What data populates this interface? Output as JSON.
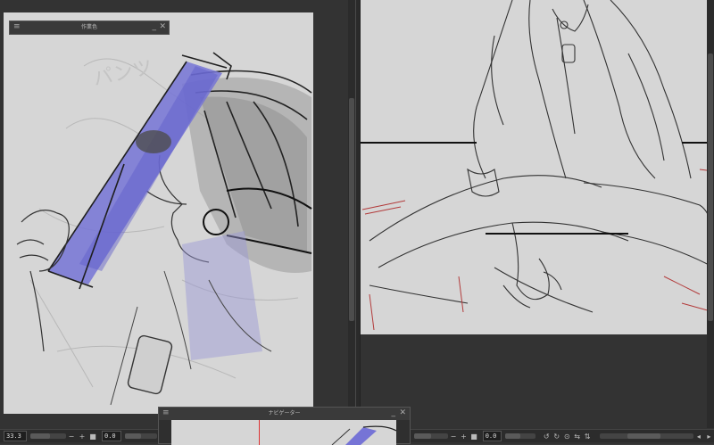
{
  "panels": {
    "layer_props_title": "作業色",
    "navigator_title": "ナビゲーター"
  },
  "left_status": {
    "zoom": "33.3",
    "angle": "0.0",
    "minus": "−",
    "plus": "+"
  },
  "right_status": {
    "zoom": "",
    "angle": "0.0",
    "minus": "−",
    "plus": "+"
  },
  "canvas_text": {
    "sketch_scribble": "パンツ"
  },
  "colors": {
    "app_bg": "#3b3b3b",
    "canvas_bg": "#d6d6d6",
    "highlight_blue": "#7a78d8"
  }
}
